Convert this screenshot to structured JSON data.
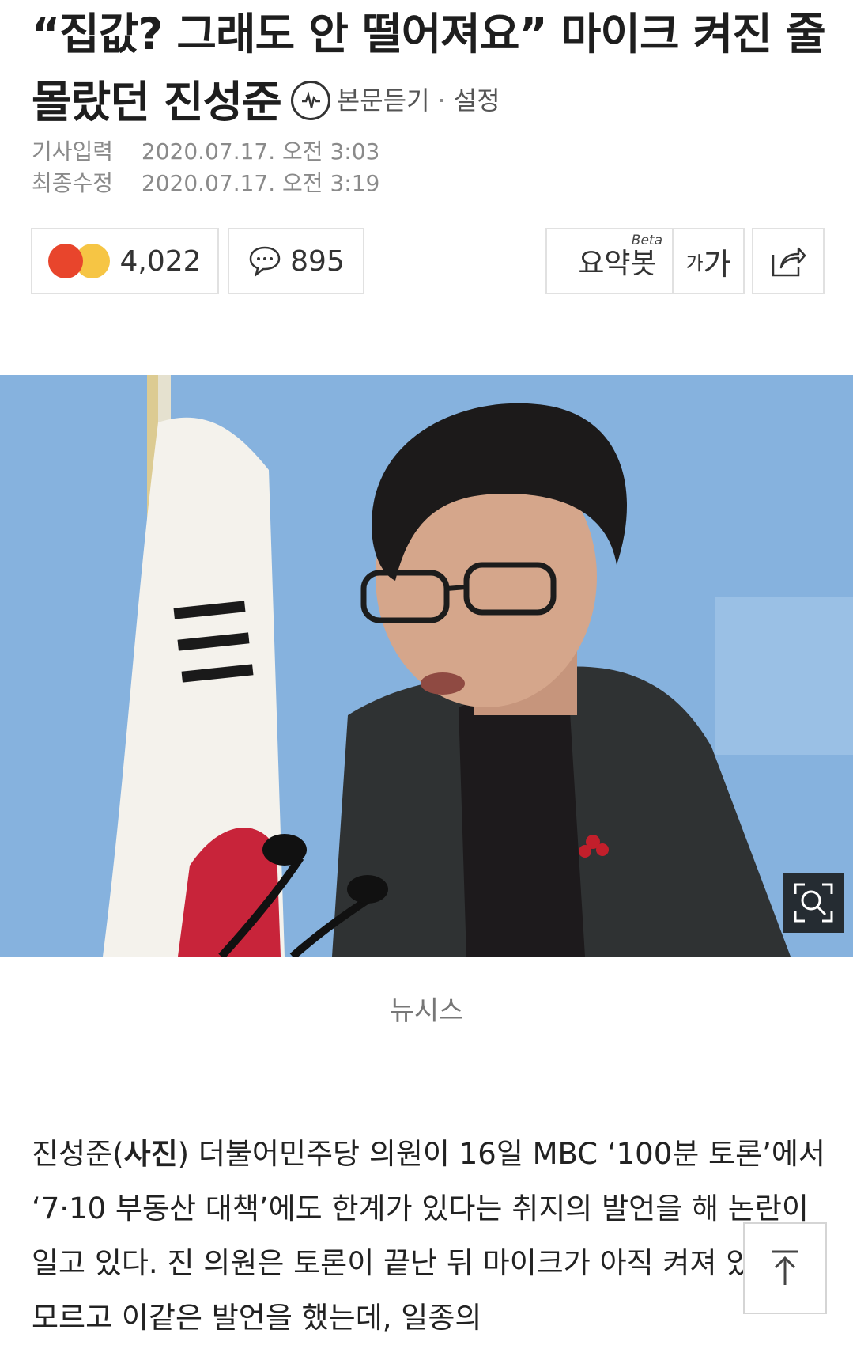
{
  "article": {
    "title": "“집값? 그래도 안 떨어져요” 마이크 켜진 줄 몰랐던 진성준",
    "listen_label": "본문듣기",
    "separator": "·",
    "settings_label": "설정"
  },
  "meta": {
    "published_label": "기사입력",
    "published_value": "2020.07.17. 오전 3:03",
    "updated_label": "최종수정",
    "updated_value": "2020.07.17. 오전 3:19"
  },
  "actions": {
    "reaction_count": "4,022",
    "comment_count": "895",
    "summary_label": "요약봇",
    "summary_badge": "Beta",
    "font_small": "가",
    "font_large": "가"
  },
  "photo": {
    "caption": "뉴시스"
  },
  "body": {
    "name": "진성준(",
    "bold_word": "사진",
    "rest": ") 더불어민주당 의원이 16일 MBC ‘100분 토론’에서 ‘7·10 부동산 대책’에도 한계가 있다는 취지의 발언을 해 논란이 일고 있다. 진 의원은 토론이 끝난 뒤 마이크가 아직 켜져 있는 줄 모르고 이같은 발언을 했는데, 일종의"
  },
  "colors": {
    "accent_angry": "#e8452c",
    "accent_laugh": "#f6c544",
    "sky_blue": "#8fb8e3"
  }
}
